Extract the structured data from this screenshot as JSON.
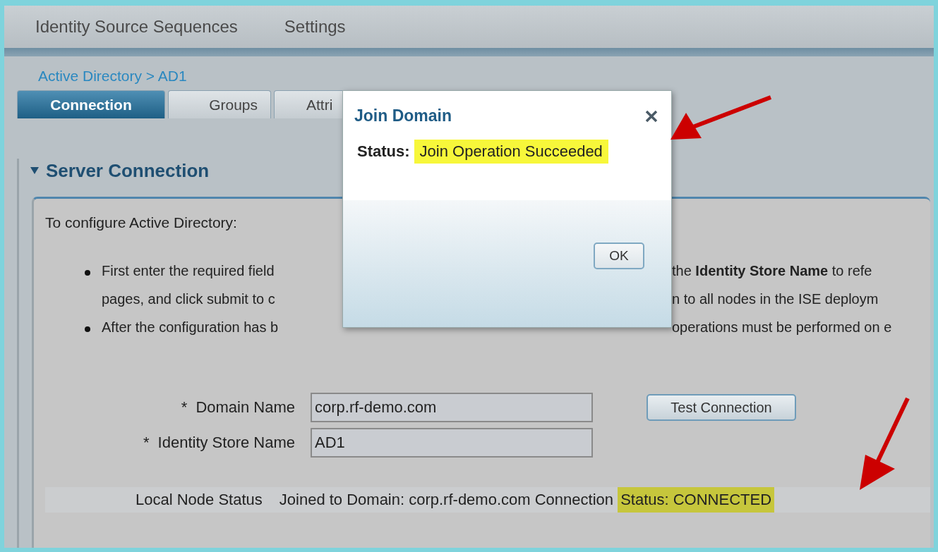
{
  "nav": {
    "items": [
      "Identity Source Sequences",
      "Settings"
    ]
  },
  "breadcrumb": "Active Directory > AD1",
  "tabs": [
    {
      "label": "Connection",
      "selected": true
    },
    {
      "label": "Groups",
      "selected": false
    },
    {
      "label": "Attri",
      "selected": false
    }
  ],
  "section": {
    "title": "Server Connection",
    "expanded": true
  },
  "intro": "To configure Active Directory:",
  "bullets": [
    {
      "lines": [
        {
          "left": "First enter the required field",
          "right": "the **Identity Store Name** to refe"
        },
        {
          "left": "pages, and click submit to c",
          "right": "n to all nodes in the ISE deploym"
        }
      ]
    },
    {
      "lines": [
        {
          "left": "After the configuration has b",
          "right": "operations must be performed on e"
        }
      ]
    }
  ],
  "fields": [
    {
      "marker": "*",
      "label": "Domain Name",
      "value": "corp.rf-demo.com"
    },
    {
      "marker": "*",
      "label": "Identity Store Name",
      "value": "AD1"
    }
  ],
  "test_button": "Test Connection",
  "node_status": {
    "label": "Local Node Status",
    "text": "Joined to Domain: corp.rf-demo.com Connection",
    "highlight": "Status: CONNECTED"
  },
  "dialog": {
    "title": "Join Domain",
    "status_label": "Status:",
    "status_value": "Join Operation Succeeded",
    "ok": "OK"
  }
}
